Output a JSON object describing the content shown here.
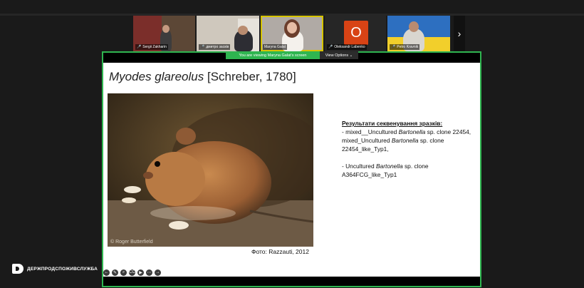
{
  "participants": [
    {
      "name": "Sergii Zakharin",
      "active": false
    },
    {
      "name": "дмитро засків",
      "active": false
    },
    {
      "name": "Maryna Galat",
      "active": true
    },
    {
      "name": "Oleksandr Labenko",
      "active": false,
      "initial": "O"
    },
    {
      "name": "Petro Kravnik",
      "active": false
    }
  ],
  "banner": {
    "viewing": "You are viewing  Maryna Galat's screen",
    "view_options": "View Options"
  },
  "slide": {
    "title_species": "Myodes glareolus",
    "title_author": " [Schreber, 1780]",
    "photo_credit": "© Roger Butterfield",
    "caption": "Фото: Razzauti, 2012",
    "results_heading": "Результати секвенування зразків:",
    "results_line1": "- mixed__Uncultured Bartonella sp. clone 22454,  mixed_Uncultured Bartonella sp. clone 22454_like_Typ1,",
    "results_line2": "- Uncultured Bartonella sp. clone A364FCG_like_Typ1"
  },
  "branding": {
    "name": "ДЕРЖПРОДСПОЖИВСЛУЖБА"
  },
  "toolbar_icons": [
    "arrow-left-icon",
    "pen-icon",
    "zoom-icon",
    "cc-icon",
    "video-icon",
    "more-icon",
    "arrow-right-icon"
  ],
  "colors": {
    "share_border": "#2fb550",
    "active_speaker": "#d6c400",
    "avatar_o": "#d84315"
  }
}
